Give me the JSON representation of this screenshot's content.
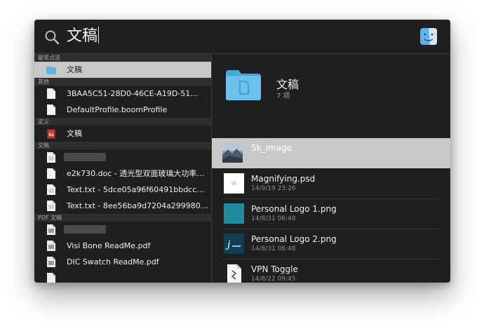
{
  "search": {
    "query": "文稿"
  },
  "left": {
    "sections": [
      {
        "header": "最常点选",
        "items": [
          {
            "label": "文稿",
            "icon": "folder-icon",
            "selected": true
          }
        ]
      },
      {
        "header": "其他",
        "items": [
          {
            "label": "3BAA5C51-28D0-46CE-A19D-51…",
            "icon": "document-icon"
          },
          {
            "label": "DefaultProfile.boomProfile",
            "icon": "document-icon"
          }
        ]
      },
      {
        "header": "定义",
        "items": [
          {
            "label": "文稿",
            "icon": "dictionary-icon"
          }
        ]
      },
      {
        "header": "文稿",
        "items": [
          {
            "label": "",
            "icon": "text-document-icon",
            "blurred": true
          },
          {
            "label": "e2k730.doc - 透光型双面玻璃大功率…",
            "icon": "document-icon"
          },
          {
            "label": "Text.txt - 5dce05a96f60491bbdcc…",
            "icon": "text-document-icon"
          },
          {
            "label": "Text.txt - 8ee56ba9d7204a299980…",
            "icon": "text-document-icon"
          }
        ]
      },
      {
        "header": "PDF 文稿",
        "items": [
          {
            "label": "",
            "icon": "pdf-icon",
            "blurred": true
          },
          {
            "label": "Visi Bone ReadMe.pdf",
            "icon": "pdf-icon"
          },
          {
            "label": "DIC Swatch ReadMe.pdf",
            "icon": "pdf-icon"
          }
        ]
      }
    ]
  },
  "preview": {
    "title": "文稿",
    "subtitle": "7 项",
    "files": [
      {
        "name": "5k_image",
        "date": "",
        "thumb": "photo-thumbnail",
        "selected": true
      },
      {
        "name": "Magnifying.psd",
        "date": "14/9/19 23:26",
        "thumb": "psd-thumbnail"
      },
      {
        "name": "Personal Logo 1.png",
        "date": "14/8/31 06:48",
        "thumb": "teal-image-thumbnail"
      },
      {
        "name": "Personal Logo 2.png",
        "date": "14/8/31 06:48",
        "thumb": "logo-thumbnail"
      },
      {
        "name": "VPN Toggle",
        "date": "14/8/22 09:45",
        "thumb": "app-document-thumbnail"
      },
      {
        "name": "",
        "date": "",
        "thumb": "blurred-thumbnail"
      }
    ]
  },
  "colors": {
    "background": "#1f1f21",
    "selection": "#c8c8c9",
    "folder": "#5ab4e6",
    "teal": "#1e8a9c"
  }
}
